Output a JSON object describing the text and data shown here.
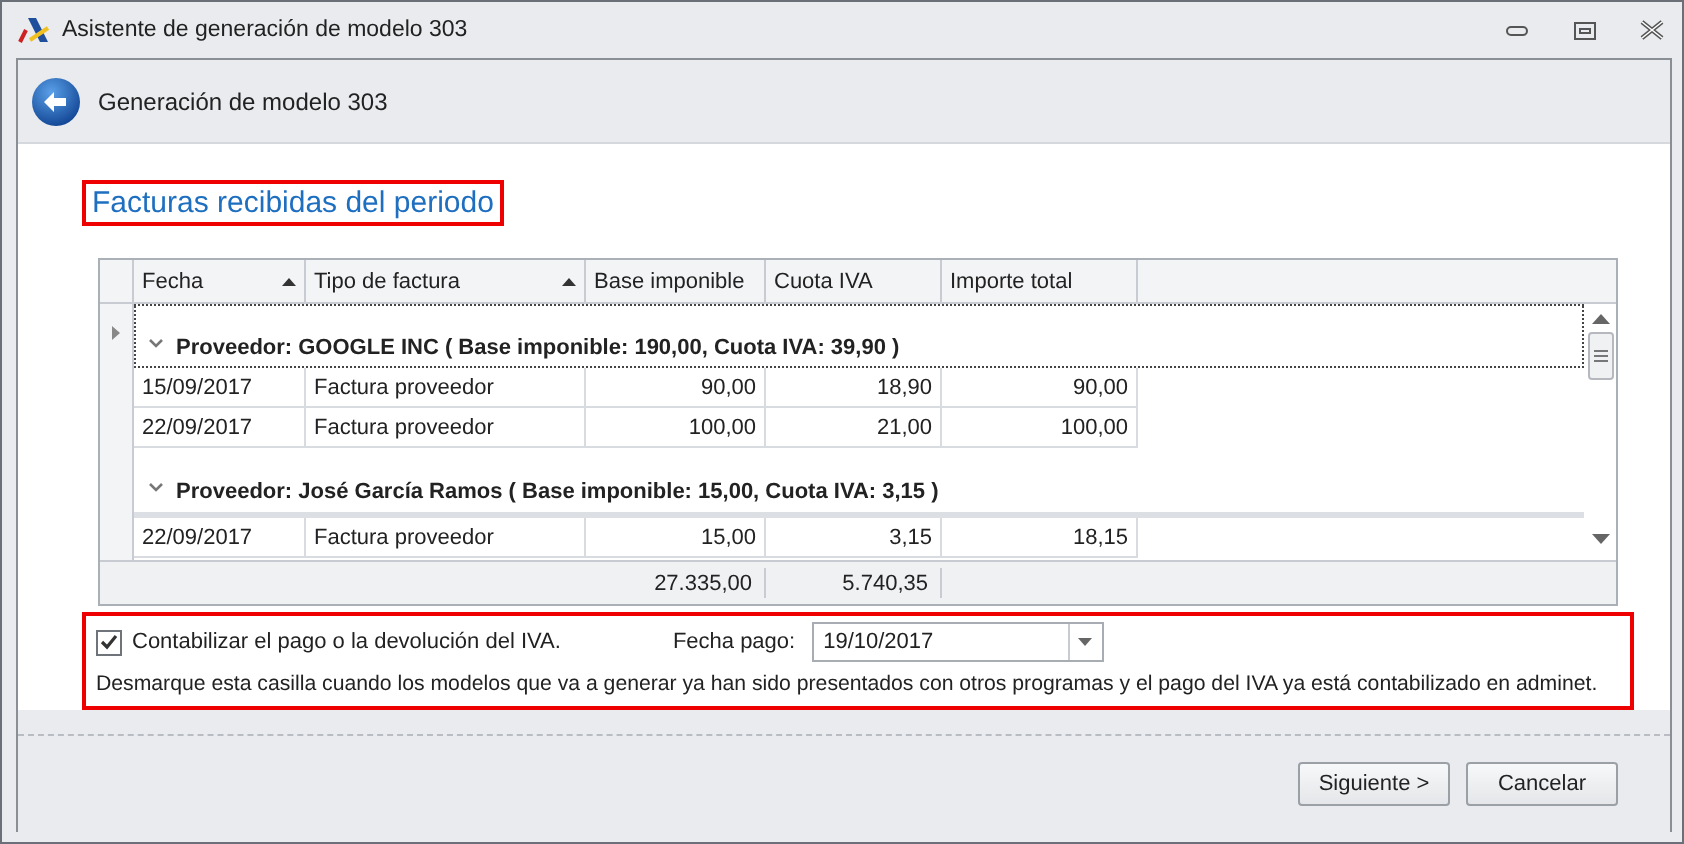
{
  "window": {
    "title": "Asistente de generación de modelo 303"
  },
  "header": {
    "title": "Generación de modelo 303"
  },
  "section_title": "Facturas recibidas del periodo",
  "grid": {
    "columns": [
      {
        "label": "Fecha",
        "sorted": true
      },
      {
        "label": "Tipo de factura",
        "sorted": true
      },
      {
        "label": "Base imponible",
        "sorted": false
      },
      {
        "label": "Cuota IVA",
        "sorted": false
      },
      {
        "label": "Importe total",
        "sorted": false
      }
    ],
    "groups": [
      {
        "label": "Proveedor: GOOGLE INC ( Base imponible: 190,00,  Cuota IVA: 39,90 )",
        "expanded": true,
        "focused": true,
        "rows": [
          [
            "15/09/2017",
            "Factura proveedor",
            "90,00",
            "18,90",
            "90,00"
          ],
          [
            "22/09/2017",
            "Factura proveedor",
            "100,00",
            "21,00",
            "100,00"
          ]
        ]
      },
      {
        "label": "Proveedor: José García Ramos ( Base imponible: 15,00,  Cuota IVA: 3,15 )",
        "expanded": true,
        "focused": false,
        "rows": [
          [
            "22/09/2017",
            "Factura proveedor",
            "15,00",
            "3,15",
            "18,15"
          ]
        ]
      }
    ],
    "totals": {
      "base_imponible": "27.335,00",
      "cuota_iva": "5.740,35"
    }
  },
  "options": {
    "checkbox": {
      "label": "Contabilizar el pago o la devolución del IVA.",
      "checked": true
    },
    "payment_date": {
      "label": "Fecha pago:",
      "value": "19/10/2017"
    },
    "note": "Desmarque esta casilla cuando los modelos que va a generar ya han sido presentados con otros programas y el pago del IVA ya está contabilizado en adminet."
  },
  "buttons": [
    {
      "label": "Siguiente >"
    },
    {
      "label": "Cancelar"
    }
  ]
}
